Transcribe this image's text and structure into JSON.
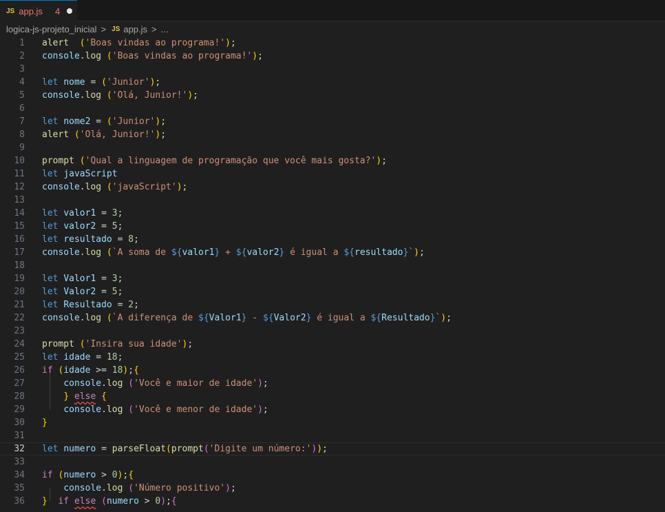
{
  "tab": {
    "icon_label": "JS",
    "file_name": "app.js",
    "problem_count": "4"
  },
  "breadcrumb": {
    "folder": "logica-js-projeto_inicial",
    "separator": ">",
    "icon_label": "JS",
    "file": "app.js",
    "more": "..."
  },
  "editor": {
    "current_line": 32,
    "lines": [
      [
        [
          "fn",
          "alert"
        ],
        [
          "",
          "  "
        ],
        [
          "p1",
          "("
        ],
        [
          "str",
          "'Boas vindas ao programa!'"
        ],
        [
          "p1",
          ")"
        ],
        [
          "",
          ";"
        ]
      ],
      [
        [
          "var",
          "console"
        ],
        [
          "",
          "."
        ],
        [
          "fn",
          "log"
        ],
        [
          "",
          " "
        ],
        [
          "p1",
          "("
        ],
        [
          "str",
          "'Boas vindas ao programa!'"
        ],
        [
          "p1",
          ")"
        ],
        [
          "",
          ";"
        ]
      ],
      [],
      [
        [
          "kw",
          "let"
        ],
        [
          "",
          " "
        ],
        [
          "var",
          "nome"
        ],
        [
          "",
          " = "
        ],
        [
          "p1",
          "("
        ],
        [
          "str",
          "'Junior'"
        ],
        [
          "p1",
          ")"
        ],
        [
          "",
          ";"
        ]
      ],
      [
        [
          "var",
          "console"
        ],
        [
          "",
          "."
        ],
        [
          "fn",
          "log"
        ],
        [
          "",
          " "
        ],
        [
          "p1",
          "("
        ],
        [
          "str",
          "'Olá, Junior!'"
        ],
        [
          "p1",
          ")"
        ],
        [
          "",
          ";"
        ]
      ],
      [],
      [
        [
          "kw",
          "let"
        ],
        [
          "",
          " "
        ],
        [
          "var",
          "nome2"
        ],
        [
          "",
          " = "
        ],
        [
          "p1",
          "("
        ],
        [
          "str",
          "'Junior'"
        ],
        [
          "p1",
          ")"
        ],
        [
          "",
          ";"
        ]
      ],
      [
        [
          "fn",
          "alert"
        ],
        [
          "",
          " "
        ],
        [
          "p1",
          "("
        ],
        [
          "str",
          "'Olá, Junior!'"
        ],
        [
          "p1",
          ")"
        ],
        [
          "",
          ";"
        ]
      ],
      [],
      [
        [
          "fn",
          "prompt"
        ],
        [
          "",
          " "
        ],
        [
          "p1",
          "("
        ],
        [
          "str",
          "'Qual a linguagem de programação que você mais gosta?'"
        ],
        [
          "p1",
          ")"
        ],
        [
          "",
          ";"
        ]
      ],
      [
        [
          "kw",
          "let"
        ],
        [
          "",
          " "
        ],
        [
          "var",
          "javaScript"
        ]
      ],
      [
        [
          "var",
          "console"
        ],
        [
          "",
          "."
        ],
        [
          "fn",
          "log"
        ],
        [
          "",
          " "
        ],
        [
          "p1",
          "("
        ],
        [
          "str",
          "'javaScript'"
        ],
        [
          "p1",
          ")"
        ],
        [
          "",
          ";"
        ]
      ],
      [],
      [
        [
          "kw",
          "let"
        ],
        [
          "",
          " "
        ],
        [
          "var",
          "valor1"
        ],
        [
          "",
          " = "
        ],
        [
          "num",
          "3"
        ],
        [
          "",
          ";"
        ]
      ],
      [
        [
          "kw",
          "let"
        ],
        [
          "",
          " "
        ],
        [
          "var",
          "valor2"
        ],
        [
          "",
          " = "
        ],
        [
          "num",
          "5"
        ],
        [
          "",
          ";"
        ]
      ],
      [
        [
          "kw",
          "let"
        ],
        [
          "",
          " "
        ],
        [
          "var",
          "resultado"
        ],
        [
          "",
          " = "
        ],
        [
          "num",
          "8"
        ],
        [
          "",
          ";"
        ]
      ],
      [
        [
          "var",
          "console"
        ],
        [
          "",
          "."
        ],
        [
          "fn",
          "log"
        ],
        [
          "",
          " "
        ],
        [
          "p1",
          "("
        ],
        [
          "str",
          "`A soma de "
        ],
        [
          "tpl",
          "${"
        ],
        [
          "var",
          "valor1"
        ],
        [
          "tpl",
          "}"
        ],
        [
          "str",
          " + "
        ],
        [
          "tpl",
          "${"
        ],
        [
          "var",
          "valor2"
        ],
        [
          "tpl",
          "}"
        ],
        [
          "str",
          " é igual a "
        ],
        [
          "tpl",
          "${"
        ],
        [
          "var",
          "resultado"
        ],
        [
          "tpl",
          "}"
        ],
        [
          "str",
          "`"
        ],
        [
          "p1",
          ")"
        ],
        [
          "",
          ";"
        ]
      ],
      [],
      [
        [
          "kw",
          "let"
        ],
        [
          "",
          " "
        ],
        [
          "var",
          "Valor1"
        ],
        [
          "",
          " = "
        ],
        [
          "num",
          "3"
        ],
        [
          "",
          ";"
        ]
      ],
      [
        [
          "kw",
          "let"
        ],
        [
          "",
          " "
        ],
        [
          "var",
          "Valor2"
        ],
        [
          "",
          " = "
        ],
        [
          "num",
          "5"
        ],
        [
          "",
          ";"
        ]
      ],
      [
        [
          "kw",
          "let"
        ],
        [
          "",
          " "
        ],
        [
          "var",
          "Resultado"
        ],
        [
          "",
          " = "
        ],
        [
          "num",
          "2"
        ],
        [
          "",
          ";"
        ]
      ],
      [
        [
          "var",
          "console"
        ],
        [
          "",
          "."
        ],
        [
          "fn",
          "log"
        ],
        [
          "",
          " "
        ],
        [
          "p1",
          "("
        ],
        [
          "str",
          "`A diferença de "
        ],
        [
          "tpl",
          "${"
        ],
        [
          "var",
          "Valor1"
        ],
        [
          "tpl",
          "}"
        ],
        [
          "str",
          " - "
        ],
        [
          "tpl",
          "${"
        ],
        [
          "var",
          "Valor2"
        ],
        [
          "tpl",
          "}"
        ],
        [
          "str",
          " é igual a "
        ],
        [
          "tpl",
          "${"
        ],
        [
          "var",
          "Resultado"
        ],
        [
          "tpl",
          "}"
        ],
        [
          "str",
          "`"
        ],
        [
          "p1",
          ")"
        ],
        [
          "",
          ";"
        ]
      ],
      [],
      [
        [
          "fn",
          "prompt"
        ],
        [
          "",
          " "
        ],
        [
          "p1",
          "("
        ],
        [
          "str",
          "'Insira sua idade'"
        ],
        [
          "p1",
          ")"
        ],
        [
          "",
          ";"
        ]
      ],
      [
        [
          "kw",
          "let"
        ],
        [
          "",
          " "
        ],
        [
          "var",
          "idade"
        ],
        [
          "",
          " = "
        ],
        [
          "num",
          "18"
        ],
        [
          "",
          ";"
        ]
      ],
      [
        [
          "ctl",
          "if"
        ],
        [
          "",
          " "
        ],
        [
          "p1",
          "("
        ],
        [
          "var",
          "idade"
        ],
        [
          "",
          " >= "
        ],
        [
          "num",
          "18"
        ],
        [
          "p1",
          ")"
        ],
        [
          "",
          ";"
        ],
        [
          "p1",
          "{"
        ]
      ],
      [
        [
          "",
          "    "
        ],
        [
          "var",
          "console"
        ],
        [
          "",
          "."
        ],
        [
          "fn",
          "log"
        ],
        [
          "",
          " "
        ],
        [
          "p2",
          "("
        ],
        [
          "str",
          "'Você e maior de idade'"
        ],
        [
          "p2",
          ")"
        ],
        [
          "",
          ";"
        ]
      ],
      [
        [
          "",
          "    "
        ],
        [
          "p1",
          "}"
        ],
        [
          "",
          " "
        ],
        [
          "ctl err",
          "else"
        ],
        [
          "",
          " "
        ],
        [
          "p1",
          "{"
        ]
      ],
      [
        [
          "",
          "    "
        ],
        [
          "var",
          "console"
        ],
        [
          "",
          "."
        ],
        [
          "fn",
          "log"
        ],
        [
          "",
          " "
        ],
        [
          "p2",
          "("
        ],
        [
          "str",
          "'Você e menor de idade'"
        ],
        [
          "p2",
          ")"
        ],
        [
          "",
          ";"
        ]
      ],
      [
        [
          "p1",
          "}"
        ]
      ],
      [],
      [
        [
          "kw",
          "let"
        ],
        [
          "",
          " "
        ],
        [
          "var",
          "numero"
        ],
        [
          "",
          " = "
        ],
        [
          "fn",
          "parseFloat"
        ],
        [
          "p1",
          "("
        ],
        [
          "fn",
          "prompt"
        ],
        [
          "p2",
          "("
        ],
        [
          "str",
          "'Digite um número:'"
        ],
        [
          "p2",
          ")"
        ],
        [
          "p1",
          ")"
        ],
        [
          "",
          ";"
        ]
      ],
      [],
      [
        [
          "ctl",
          "if"
        ],
        [
          "",
          " "
        ],
        [
          "p1",
          "("
        ],
        [
          "var",
          "numero"
        ],
        [
          "",
          " > "
        ],
        [
          "num",
          "0"
        ],
        [
          "p1",
          ")"
        ],
        [
          "",
          ";"
        ],
        [
          "p1",
          "{"
        ]
      ],
      [
        [
          "",
          "    "
        ],
        [
          "var",
          "console"
        ],
        [
          "",
          "."
        ],
        [
          "fn",
          "log"
        ],
        [
          "",
          " "
        ],
        [
          "p2",
          "("
        ],
        [
          "str",
          "'Número positivo'"
        ],
        [
          "p2",
          ")"
        ],
        [
          "",
          ";"
        ]
      ],
      [
        [
          "p1",
          "}"
        ],
        [
          "",
          "  "
        ],
        [
          "ctl",
          "if"
        ],
        [
          "",
          " "
        ],
        [
          "ctl err",
          "else"
        ],
        [
          "",
          " "
        ],
        [
          "p2",
          "("
        ],
        [
          "var",
          "numero"
        ],
        [
          "",
          " > "
        ],
        [
          "num",
          "0"
        ],
        [
          "p2",
          ")"
        ],
        [
          "",
          ";"
        ],
        [
          "p2",
          "{"
        ]
      ]
    ]
  }
}
